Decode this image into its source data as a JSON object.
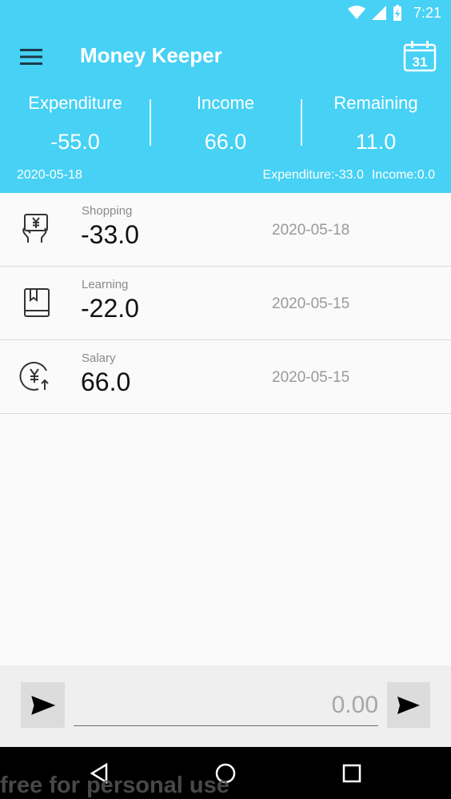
{
  "status": {
    "time": "7:21"
  },
  "app": {
    "title": "Money Keeper",
    "calendar_day": "31"
  },
  "summary": {
    "expenditure_label": "Expenditure",
    "expenditure_value": "-55.0",
    "income_label": "Income",
    "income_value": "66.0",
    "remaining_label": "Remaining",
    "remaining_value": "11.0"
  },
  "daily": {
    "date": "2020-05-18",
    "expenditure": "Expenditure:-33.0",
    "income": "Income:0.0"
  },
  "records": [
    {
      "category": "Shopping",
      "amount": "-33.0",
      "date": "2020-05-18",
      "icon": "shopping-icon"
    },
    {
      "category": "Learning",
      "amount": "-22.0",
      "date": "2020-05-15",
      "icon": "book-icon"
    },
    {
      "category": "Salary",
      "amount": "66.0",
      "date": "2020-05-15",
      "icon": "salary-icon"
    }
  ],
  "input": {
    "placeholder": "0.00"
  },
  "watermark": "free for personal use",
  "colors": {
    "accent": "#46d1f5",
    "background": "#fafafa"
  }
}
